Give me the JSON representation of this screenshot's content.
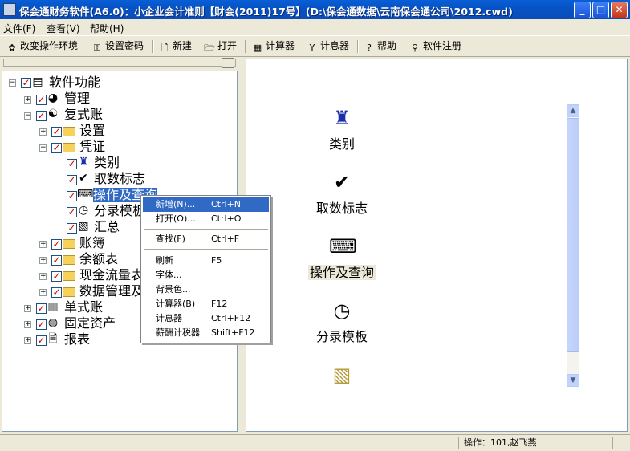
{
  "window": {
    "title": "保会通财务软件(A6.0)：小企业会计准则【财会(2011)17号】(D:\\保会通数据\\云南保会通公司\\2012.cwd)"
  },
  "window_buttons": {
    "minimize": "_",
    "maximize": "□",
    "close": "✕"
  },
  "menubar": {
    "items": [
      "文件(F)",
      "查看(V)",
      "帮助(H)"
    ]
  },
  "toolbar": {
    "change_env": "改变操作环境",
    "set_password": "设置密码",
    "new": "新建",
    "open": "打开",
    "calculator": "计算器",
    "abacus": "计息器",
    "help": "帮助",
    "register": "软件注册"
  },
  "tree": {
    "root": "软件功能",
    "manage": "管理",
    "double_ledger": "复式账",
    "settings": "设置",
    "voucher": "凭证",
    "category": "类别",
    "fetch_flag": "取数标志",
    "op_query": "操作及查询",
    "entry_template": "分录模板",
    "summary": "汇总",
    "books": "账簿",
    "balance_sheet": "余额表",
    "cash_flow": "现金流量表",
    "data_mgmt": "数据管理及",
    "single_ledger": "单式账",
    "fixed_assets": "固定资产",
    "reports": "报表"
  },
  "context_menu": {
    "items": [
      {
        "label": "新增(N)...",
        "shortcut": "Ctrl+N"
      },
      {
        "label": "打开(O)...",
        "shortcut": "Ctrl+O"
      },
      {
        "label": "查找(F)",
        "shortcut": "Ctrl+F"
      },
      {
        "label": "刷新",
        "shortcut": "F5"
      },
      {
        "label": "字体...",
        "shortcut": ""
      },
      {
        "label": "背景色...",
        "shortcut": ""
      },
      {
        "label": "计算器(B)",
        "shortcut": "F12"
      },
      {
        "label": "计息器",
        "shortcut": "Ctrl+F12"
      },
      {
        "label": "薪酬计税器",
        "shortcut": "Shift+F12"
      }
    ]
  },
  "main": {
    "items": [
      {
        "label": "类别",
        "icon": "ink-pot-icon"
      },
      {
        "label": "取数标志",
        "icon": "check-mark-icon"
      },
      {
        "label": "操作及查询",
        "icon": "keyboard-icon"
      },
      {
        "label": "分录模板",
        "icon": "clock-doc-icon"
      },
      {
        "label": "",
        "icon": "summary-docs-icon"
      }
    ]
  },
  "statusbar": {
    "operator": "操作：101,赵飞燕"
  },
  "colors": {
    "selection": "#316ac5",
    "titlebar": "#0653c6",
    "folder": "#f6d25a",
    "check": "#cc0000"
  }
}
